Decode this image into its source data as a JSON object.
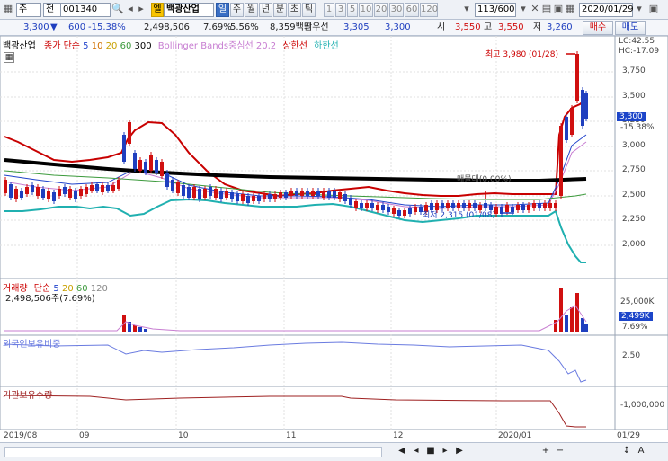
{
  "toolbar": {
    "market": "주",
    "market2": "전",
    "code": "001340",
    "tag": "엘",
    "name": "백광산업",
    "periods": [
      "일",
      "주",
      "월",
      "년",
      "분",
      "초",
      "틱"
    ],
    "active_period": "일",
    "numbers": [
      "1",
      "3",
      "5",
      "10",
      "20",
      "30",
      "60",
      "120"
    ],
    "count": "113/600",
    "date": "2020/01/29",
    "buy": "매수",
    "sell": "매도"
  },
  "quote": {
    "price": "3,300",
    "change": "600",
    "change_pct": "-15.38%",
    "volume": "2,498,506",
    "vol_pct": "7.69%",
    "turnover_pct": "5.56%",
    "amount": "8,359백만",
    "best_ask_label": "최우선",
    "best_ask": "3,305",
    "best_bid": "3,300",
    "open_label": "시",
    "open": "3,550",
    "high_label": "고",
    "high": "3,550",
    "low_label": "저",
    "low": "3,260"
  },
  "price_panel": {
    "name": "백광산업",
    "ma_label": "종가 단순",
    "ma_periods": [
      "5",
      "10",
      "20",
      "60",
      "300"
    ],
    "bb_label": "Bollinger Bands중심선 20,2",
    "upper_label": "상한선",
    "lower_label": "하한선",
    "lc": "LC:42.55",
    "hc": "HC:-17.09",
    "y_ticks": [
      "3,750",
      "3,500",
      "3,250",
      "3,000",
      "2,750",
      "2,500",
      "2,250",
      "2,000"
    ],
    "current_price": "3,300",
    "current_pct": "-15.38%",
    "max_label": "최고 3,980 (01/28)",
    "min_label": "최저 2,315 (01/08)",
    "ma300_label": "매물대(0.00%)"
  },
  "volume_panel": {
    "title": "거래량",
    "ma_label": "단순",
    "ma_periods": [
      "5",
      "20",
      "60",
      "120"
    ],
    "value": "2,498,506주(7.69%)",
    "y_tick": "25,000K",
    "current": "2,499K",
    "current_pct": "7.69%"
  },
  "foreign_panel": {
    "title": "외국인보유비중",
    "y_tick": "2.50"
  },
  "inst_panel": {
    "title": "기관보유수량",
    "y_tick": "-1,000,000"
  },
  "x_axis": {
    "labels": [
      "2019/08",
      "09",
      "10",
      "11",
      "12",
      "2020/01",
      "01/29"
    ]
  },
  "colors": {
    "up": "#d01010",
    "down": "#1f3fbf",
    "bb": "#c80000",
    "lower": "#20b0b0",
    "ma300": "#000000"
  }
}
